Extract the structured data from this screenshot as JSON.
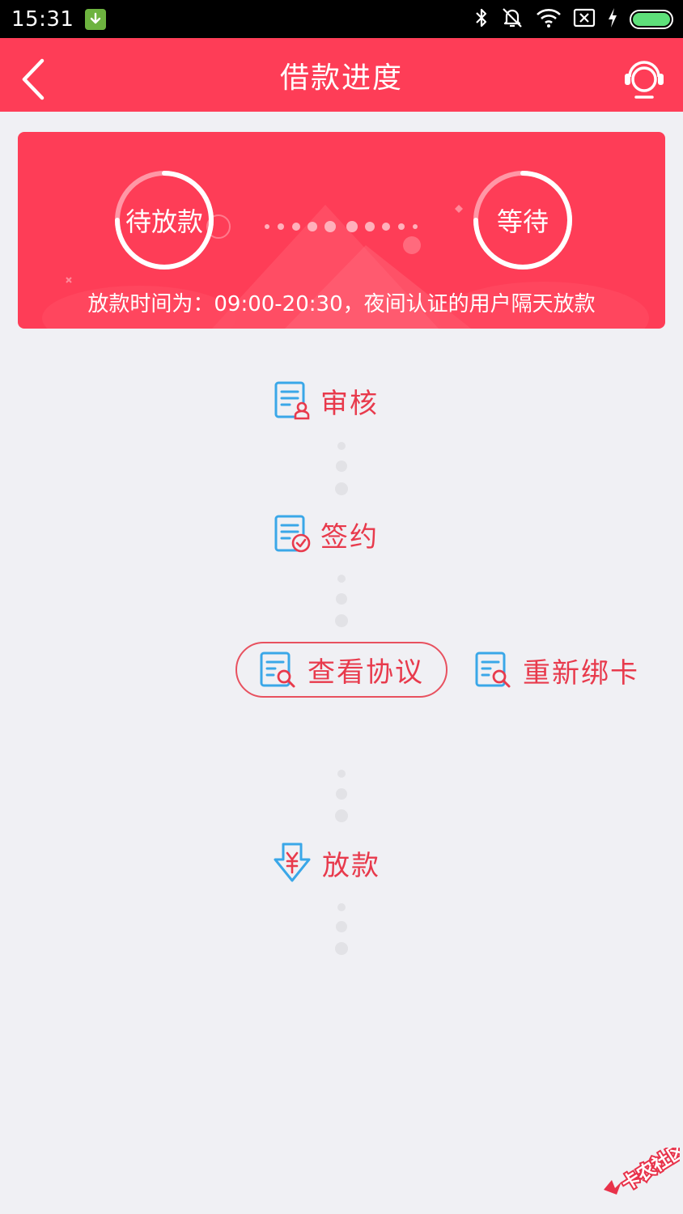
{
  "status_bar": {
    "time": "15:31"
  },
  "nav": {
    "title": "借款进度"
  },
  "banner": {
    "current_stage": "待放款",
    "next_stage": "等待",
    "note": "放款时间为：09:00-20:30，夜间认证的用户隔天放款"
  },
  "timeline": {
    "review_label": "审核",
    "sign_label": "签约",
    "view_agreement_label": "查看协议",
    "rebind_card_label": "重新绑卡",
    "disburse_label": "放款"
  },
  "watermark": {
    "text": "卡农社区"
  },
  "colors": {
    "brand": "#fe3d57",
    "step_text": "#e83a4c",
    "icon_blue": "#3aa7e8"
  }
}
